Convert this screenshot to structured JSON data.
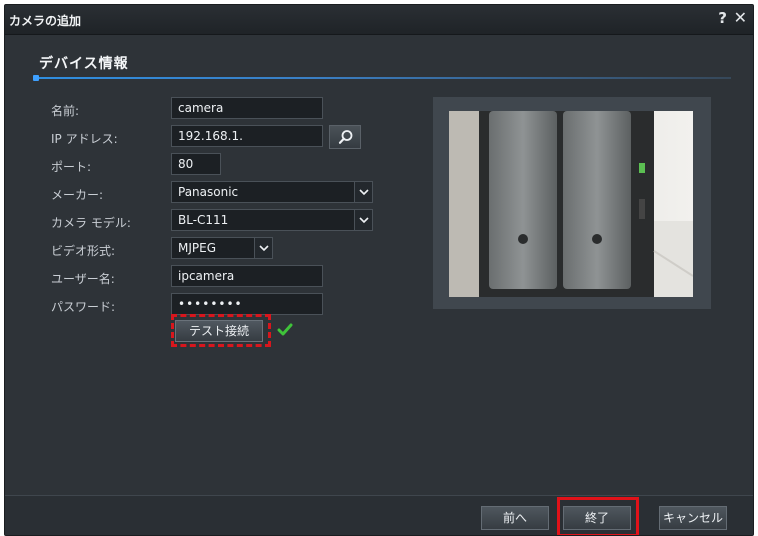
{
  "window": {
    "title": "カメラの追加",
    "help_label": "?",
    "close_label": "✕"
  },
  "section": {
    "title": "デバイス情報"
  },
  "form": {
    "name": {
      "label": "名前:",
      "value": "camera"
    },
    "ip": {
      "label": "IP アドレス:",
      "value": "192.168.1."
    },
    "port": {
      "label": "ポート:",
      "value": "80"
    },
    "maker": {
      "label": "メーカー:",
      "value": "Panasonic"
    },
    "model": {
      "label": "カメラ モデル:",
      "value": "BL-C111"
    },
    "video_format": {
      "label": "ビデオ形式:",
      "value": "MJPEG"
    },
    "username": {
      "label": "ユーザー名:",
      "value": "ipcamera"
    },
    "password": {
      "label": "パスワード:",
      "value": "••••••••"
    },
    "test_button": "テスト接続"
  },
  "footer": {
    "back": "前へ",
    "finish": "終了",
    "cancel": "キャンセル"
  },
  "colors": {
    "accent": "#2f8ee0",
    "highlight": "#e01219",
    "check": "#3fc33a"
  },
  "icons": [
    "search-icon",
    "check-icon",
    "chevron-down-icon"
  ]
}
